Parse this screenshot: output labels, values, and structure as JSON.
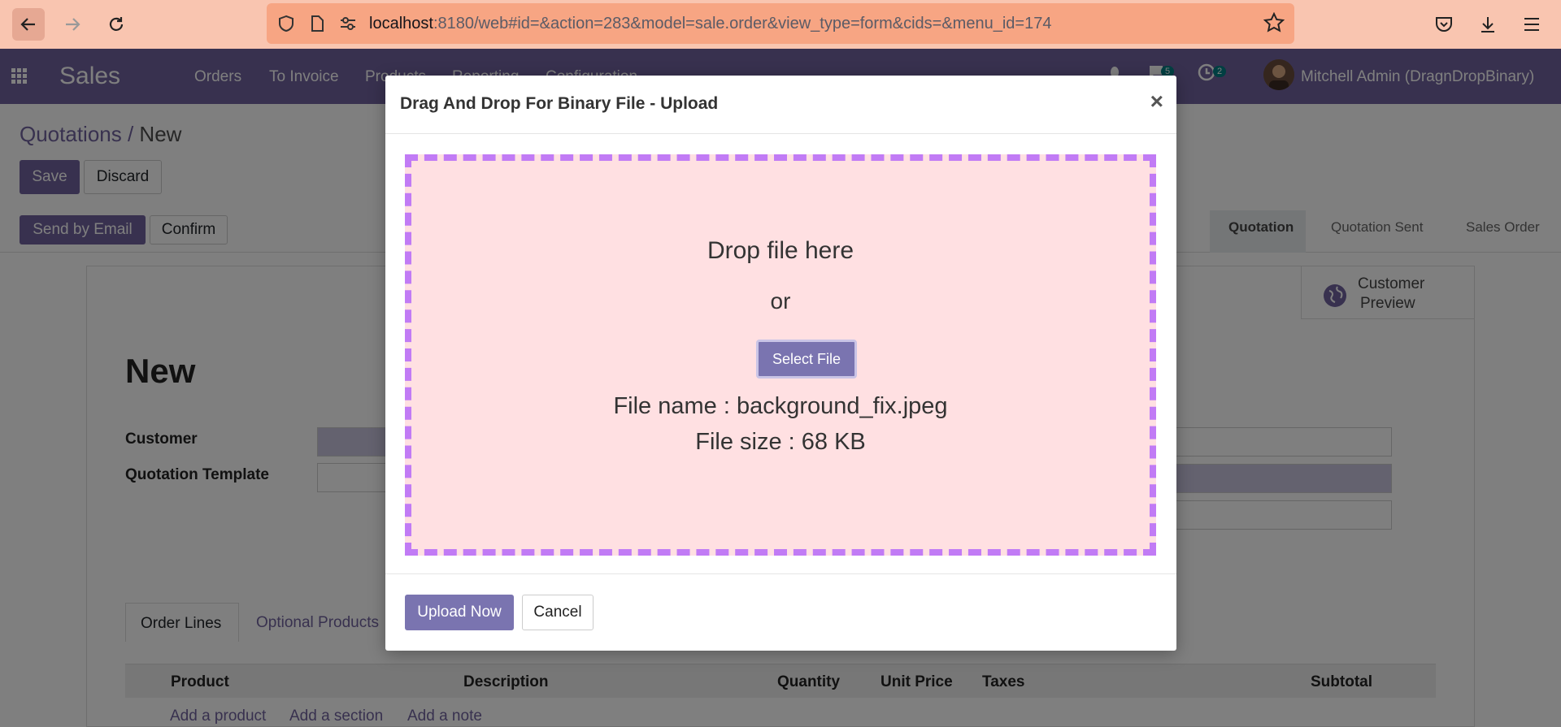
{
  "browser": {
    "url_host": "localhost",
    "url_rest": ":8180/web#id=&action=283&model=sale.order&view_type=form&cids=&menu_id=174"
  },
  "app": {
    "name": "Sales",
    "menu": [
      "Orders",
      "To Invoice",
      "Products",
      "Reporting",
      "Configuration"
    ],
    "messages_count": "5",
    "activities_count": "2",
    "user": "Mitchell Admin (DragnDropBinary)"
  },
  "breadcrumb": {
    "parent": "Quotations",
    "separator": " / ",
    "current": "New"
  },
  "actions": {
    "save": "Save",
    "discard": "Discard",
    "send_email": "Send by Email",
    "confirm": "Confirm"
  },
  "status_stages": [
    "Quotation",
    "Quotation Sent",
    "Sales Order"
  ],
  "form": {
    "preview_line1": "Customer",
    "preview_line2": "Preview",
    "title": "New",
    "customer_label": "Customer",
    "template_label": "Quotation Template",
    "tabs": [
      "Order Lines",
      "Optional Products"
    ],
    "columns": [
      "Product",
      "Description",
      "Quantity",
      "Unit Price",
      "Taxes",
      "Subtotal"
    ],
    "add_links": [
      "Add a product",
      "Add a section",
      "Add a note"
    ]
  },
  "modal": {
    "title": "Drag And Drop For Binary File - Upload",
    "close": "×",
    "drop_text": "Drop file here",
    "or_text": "or",
    "select_file": "Select File",
    "file_name": "File name : background_fix.jpeg",
    "file_size": "File size : 68 KB",
    "upload_now": "Upload Now",
    "cancel": "Cancel"
  }
}
